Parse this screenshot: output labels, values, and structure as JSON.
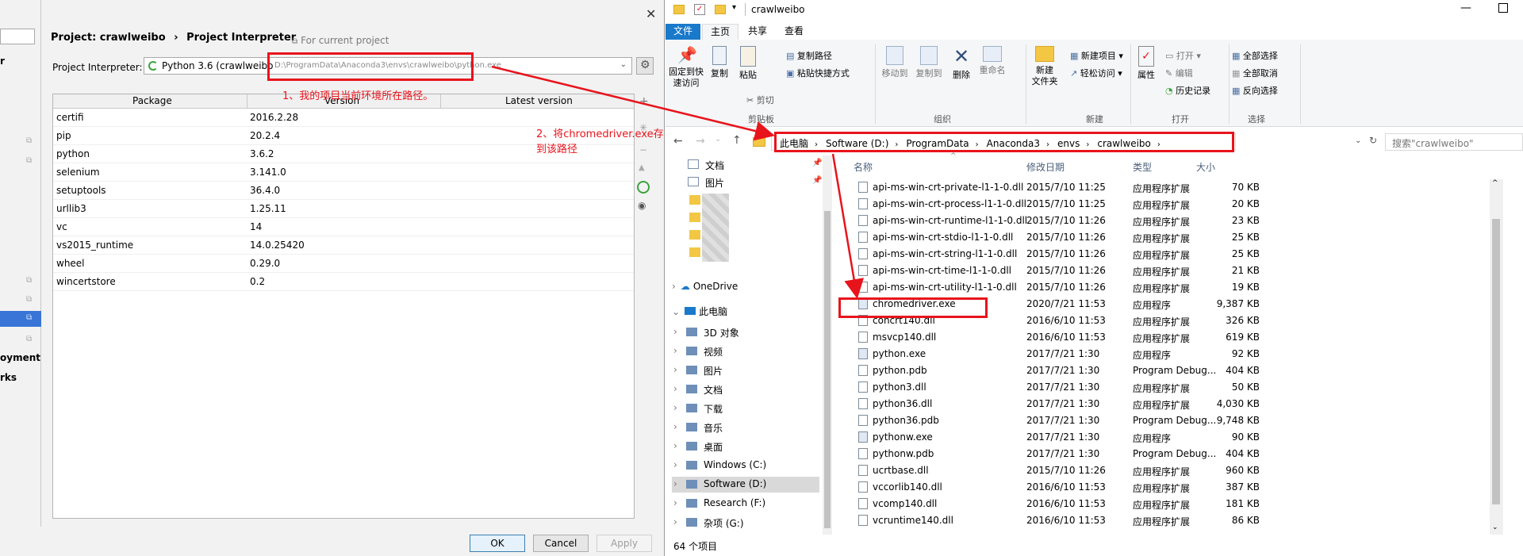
{
  "settings": {
    "breadcrumb_project": "Project: crawlweibo",
    "breadcrumb_sep": "›",
    "breadcrumb_page": "Project Interpreter",
    "for_current_project": "For current project",
    "left_nav_items": [
      "r",
      "oyment",
      "rks"
    ],
    "interpreter_label": "Project Interpreter:",
    "interpreter_value": "Python 3.6 (crawlweibo",
    "interpreter_path": "D:\\ProgramData\\Anaconda3\\envs\\crawlweibo\\python.exe",
    "table_headers": [
      "Package",
      "Version",
      "Latest version"
    ],
    "packages": [
      {
        "name": "certifi",
        "version": "2016.2.28"
      },
      {
        "name": "pip",
        "version": "20.2.4"
      },
      {
        "name": "python",
        "version": "3.6.2"
      },
      {
        "name": "selenium",
        "version": "3.141.0"
      },
      {
        "name": "setuptools",
        "version": "36.4.0"
      },
      {
        "name": "urllib3",
        "version": "1.25.11"
      },
      {
        "name": "vc",
        "version": "14"
      },
      {
        "name": "vs2015_runtime",
        "version": "14.0.25420"
      },
      {
        "name": "wheel",
        "version": "0.29.0"
      },
      {
        "name": "wincertstore",
        "version": "0.2"
      }
    ],
    "side_buttons": [
      "+",
      "−",
      "▲",
      "↻",
      "◉"
    ],
    "ok": "OK",
    "cancel": "Cancel",
    "apply": "Apply",
    "close": "✕"
  },
  "annotations": {
    "note1": "1、我的项目当前环境所在路径。",
    "note2": "2、将chromedriver.exe存到该路径"
  },
  "explorer": {
    "title": "crawlweibo",
    "tabs": [
      "文件",
      "主页",
      "共享",
      "查看"
    ],
    "ribbon": {
      "pin": "固定到快\n速访问",
      "copy": "复制",
      "paste": "粘贴",
      "copy_path": "复制路径",
      "paste_shortcut": "粘贴快捷方式",
      "cut": "剪切",
      "clipboard": "剪贴板",
      "move_to": "移动到",
      "copy_to": "复制到",
      "delete": "删除",
      "rename": "重命名",
      "organize": "组织",
      "new_folder": "新建\n文件夹",
      "new_item": "新建项目 ▾",
      "easy_access": "轻松访问 ▾",
      "new": "新建",
      "properties": "属性",
      "open": "打开 ▾",
      "edit": "编辑",
      "history": "历史记录",
      "open_group": "打开",
      "select_all": "全部选择",
      "select_none": "全部取消",
      "invert": "反向选择",
      "select_group": "选择"
    },
    "path": [
      "此电脑",
      "Software (D:)",
      "ProgramData",
      "Anaconda3",
      "envs",
      "crawlweibo"
    ],
    "search_placeholder": "搜索\"crawlweibo\"",
    "nav": {
      "docs": "文档",
      "pics": "图片",
      "onedrive": "OneDrive",
      "thispc": "此电脑",
      "items": [
        "3D 对象",
        "视频",
        "图片",
        "文档",
        "下载",
        "音乐",
        "桌面",
        "Windows  (C:)",
        "Software (D:)",
        "Research (F:)",
        "杂项 (G:)"
      ]
    },
    "columns": [
      "名称",
      "修改日期",
      "类型",
      "大小"
    ],
    "files": [
      {
        "name": "api-ms-win-crt-private-l1-1-0.dll",
        "date": "2015/7/10 11:25",
        "type": "应用程序扩展",
        "size": "70 KB"
      },
      {
        "name": "api-ms-win-crt-process-l1-1-0.dll",
        "date": "2015/7/10 11:25",
        "type": "应用程序扩展",
        "size": "20 KB"
      },
      {
        "name": "api-ms-win-crt-runtime-l1-1-0.dll",
        "date": "2015/7/10 11:26",
        "type": "应用程序扩展",
        "size": "23 KB"
      },
      {
        "name": "api-ms-win-crt-stdio-l1-1-0.dll",
        "date": "2015/7/10 11:26",
        "type": "应用程序扩展",
        "size": "25 KB"
      },
      {
        "name": "api-ms-win-crt-string-l1-1-0.dll",
        "date": "2015/7/10 11:26",
        "type": "应用程序扩展",
        "size": "25 KB"
      },
      {
        "name": "api-ms-win-crt-time-l1-1-0.dll",
        "date": "2015/7/10 11:26",
        "type": "应用程序扩展",
        "size": "21 KB"
      },
      {
        "name": "api-ms-win-crt-utility-l1-1-0.dll",
        "date": "2015/7/10 11:26",
        "type": "应用程序扩展",
        "size": "19 KB"
      },
      {
        "name": "chromedriver.exe",
        "date": "2020/7/21 11:53",
        "type": "应用程序",
        "size": "9,387 KB"
      },
      {
        "name": "concrt140.dll",
        "date": "2016/6/10 11:53",
        "type": "应用程序扩展",
        "size": "326 KB"
      },
      {
        "name": "msvcp140.dll",
        "date": "2016/6/10 11:53",
        "type": "应用程序扩展",
        "size": "619 KB"
      },
      {
        "name": "python.exe",
        "date": "2017/7/21 1:30",
        "type": "应用程序",
        "size": "92 KB"
      },
      {
        "name": "python.pdb",
        "date": "2017/7/21 1:30",
        "type": "Program Debug...",
        "size": "404 KB"
      },
      {
        "name": "python3.dll",
        "date": "2017/7/21 1:30",
        "type": "应用程序扩展",
        "size": "50 KB"
      },
      {
        "name": "python36.dll",
        "date": "2017/7/21 1:30",
        "type": "应用程序扩展",
        "size": "4,030 KB"
      },
      {
        "name": "python36.pdb",
        "date": "2017/7/21 1:30",
        "type": "Program Debug...",
        "size": "9,748 KB"
      },
      {
        "name": "pythonw.exe",
        "date": "2017/7/21 1:30",
        "type": "应用程序",
        "size": "90 KB"
      },
      {
        "name": "pythonw.pdb",
        "date": "2017/7/21 1:30",
        "type": "Program Debug...",
        "size": "404 KB"
      },
      {
        "name": "ucrtbase.dll",
        "date": "2015/7/10 11:26",
        "type": "应用程序扩展",
        "size": "960 KB"
      },
      {
        "name": "vccorlib140.dll",
        "date": "2016/6/10 11:53",
        "type": "应用程序扩展",
        "size": "387 KB"
      },
      {
        "name": "vcomp140.dll",
        "date": "2016/6/10 11:53",
        "type": "应用程序扩展",
        "size": "181 KB"
      },
      {
        "name": "vcruntime140.dll",
        "date": "2016/6/10 11:53",
        "type": "应用程序扩展",
        "size": "86 KB"
      }
    ],
    "status": "64 个项目",
    "colors": {
      "accent": "#1979ca",
      "annotation": "#e8141c"
    }
  }
}
